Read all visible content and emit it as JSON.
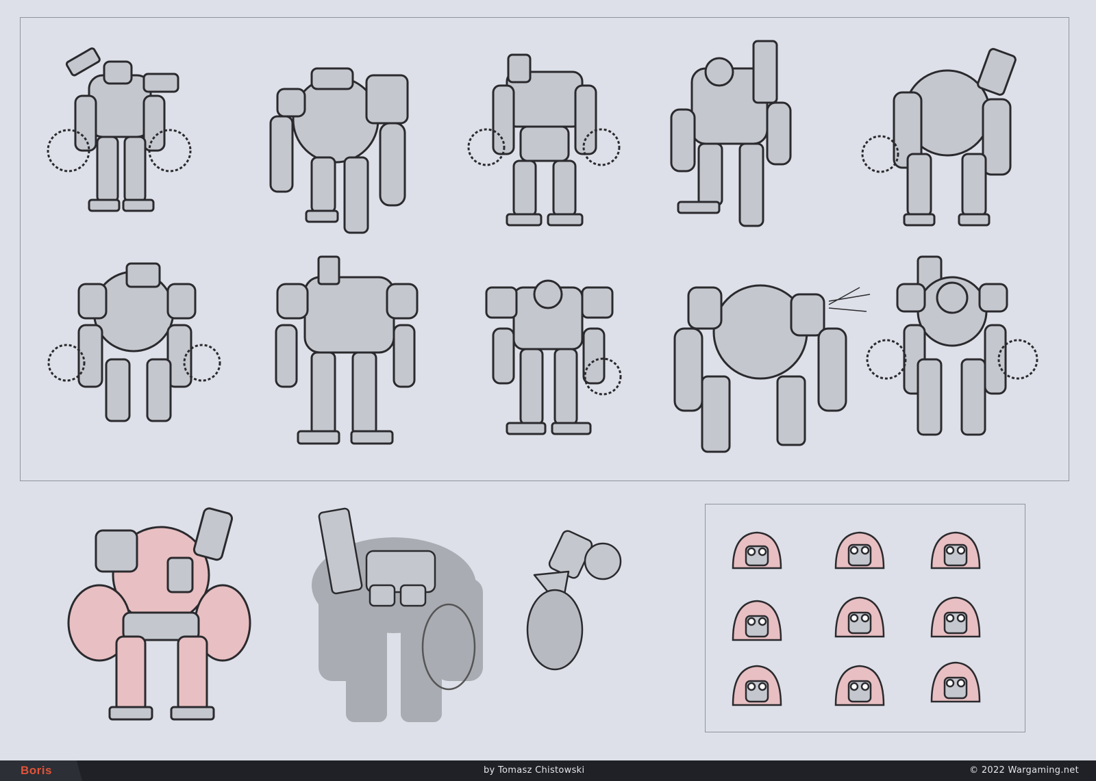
{
  "footer": {
    "title": "Boris",
    "credit": "by Tomasz Chistowski",
    "copyright": "© 2022 Wargaming.net"
  },
  "colors": {
    "background": "#dde0e8",
    "footer": "#1f2126",
    "title_accent": "#e1533a",
    "sketch_line": "#2a2a2e",
    "sketch_fill": "#c4c7ce",
    "pink_tint": "#e8bfc2",
    "silhouette": "#a9acb2"
  },
  "sheet": {
    "robot_sketch_rows": 2,
    "robot_sketches_per_row": 5,
    "head_study_rows": 3,
    "head_studies_per_row": 3
  }
}
